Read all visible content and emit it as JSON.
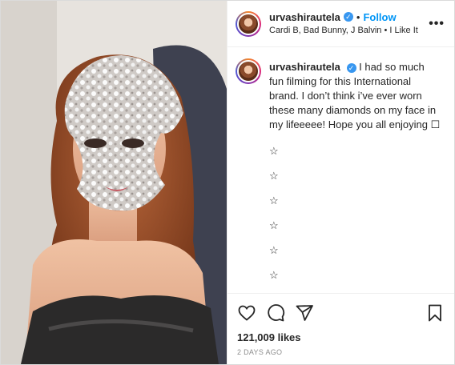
{
  "post": {
    "username": "urvashirautela",
    "verified_mark": "✓",
    "separator": "•",
    "follow_label": "Follow",
    "audio_line": "Cardi B, Bad Bunny, J Balvin • I Like It",
    "more_label": "•••"
  },
  "caption": {
    "username": "urvashirautela",
    "text": "I had so much fun filming for this International brand. I don’t think i’ve ever worn these many diamonds on my face in my lifeeeee! Hope you all enjoying ☐",
    "stars": [
      "☆",
      "☆",
      "☆",
      "☆",
      "☆",
      "☆",
      "☆"
    ]
  },
  "actions": {
    "icons": [
      "heart-icon",
      "comment-icon",
      "share-icon",
      "bookmark-icon"
    ]
  },
  "stats": {
    "likes": "121,009 likes",
    "time_ago": "2 DAYS AGO"
  },
  "colors": {
    "accent": "#0095f6",
    "verified": "#3897f0",
    "text": "#262626",
    "muted": "#8e8e8e"
  }
}
